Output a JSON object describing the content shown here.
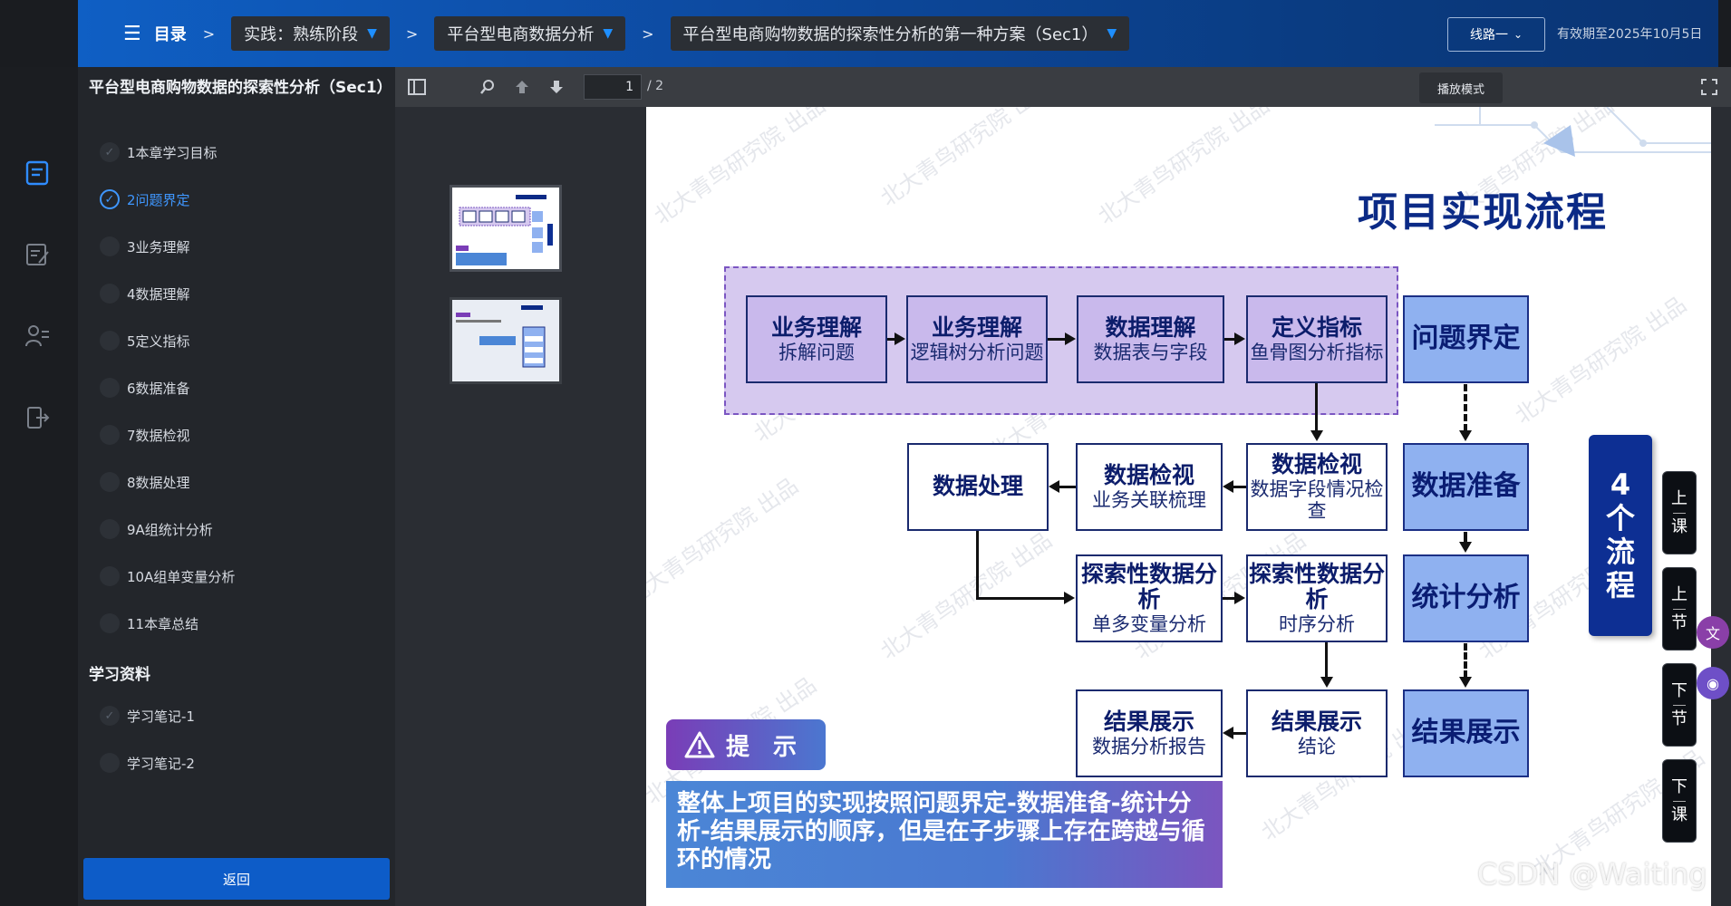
{
  "topbar": {
    "menu_label": "目录",
    "crumbs": [
      "实践：熟练阶段",
      "平台型电商数据分析",
      "平台型电商购物数据的探索性分析的第一种方案（Sec1）"
    ],
    "route_label": "线路一",
    "valid_until": "有效期至2025年10月5日"
  },
  "outline": {
    "title": "平台型电商购物数据的探索性分析（Sec1）",
    "items": [
      {
        "label": "1本章学习目标"
      },
      {
        "label": "2问题界定"
      },
      {
        "label": "3业务理解"
      },
      {
        "label": "4数据理解"
      },
      {
        "label": "5定义指标"
      },
      {
        "label": "6数据准备"
      },
      {
        "label": "7数据检视"
      },
      {
        "label": "8数据处理"
      },
      {
        "label": "9A组统计分析"
      },
      {
        "label": "10A组单变量分析"
      },
      {
        "label": "11本章总结"
      }
    ],
    "materials_title": "学习资料",
    "materials": [
      {
        "label": "学习笔记-1"
      },
      {
        "label": "学习笔记-2"
      }
    ],
    "back_label": "返回"
  },
  "viewer": {
    "page_current": "1",
    "page_total": "/ 2",
    "play_mode": "播放模式"
  },
  "slide": {
    "title": "项目实现流程",
    "watermark": "北大青鸟研究院 出品",
    "boxes": {
      "biz": {
        "h": "业务理解",
        "s": "拆解问题"
      },
      "logic": {
        "h": "业务理解",
        "s": "逻辑树分析问题"
      },
      "data_understand": {
        "h": "数据理解",
        "s": "数据表与字段"
      },
      "metric": {
        "h": "定义指标",
        "s": "鱼骨图分析指标"
      },
      "problem": {
        "h": "问题界定"
      },
      "process": {
        "h": "数据处理"
      },
      "inspect1": {
        "h": "数据检视",
        "s": "业务关联梳理"
      },
      "inspect2": {
        "h": "数据检视",
        "s": "数据字段情况检查"
      },
      "prepare": {
        "h": "数据准备"
      },
      "eda1": {
        "h": "探索性数据分析",
        "s": "单多变量分析"
      },
      "eda2": {
        "h": "探索性数据分析",
        "s": "时序分析"
      },
      "stats": {
        "h": "统计分析"
      },
      "report": {
        "h": "结果展示",
        "s": "数据分析报告"
      },
      "conclusion": {
        "h": "结果展示",
        "s": "结论"
      },
      "result": {
        "h": "结果展示"
      }
    },
    "side_label": [
      "4",
      "个",
      "流",
      "程"
    ],
    "tip_label": "提　示",
    "tip_text": "整体上项目的实现按照问题界定-数据准备-统计分析-结果展示的顺序，但是在子步骤上存在跨越与循环的情况"
  },
  "side_nav": [
    {
      "top": "上",
      "bottom": "课"
    },
    {
      "top": "上",
      "bottom": "节"
    },
    {
      "top": "下",
      "bottom": "节"
    },
    {
      "top": "下",
      "bottom": "课"
    }
  ],
  "footer_mark": "CSDN @Waiting",
  "colors": {
    "accent": "#0d5cc8",
    "active": "#3f97ff",
    "slide_title": "#0b2a86"
  }
}
